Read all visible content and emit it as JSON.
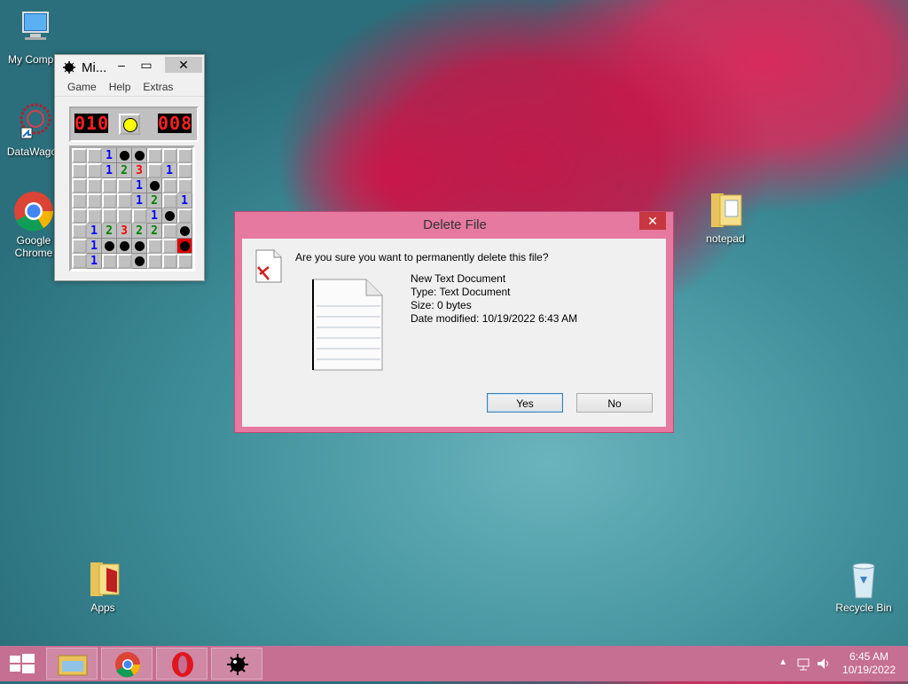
{
  "desktop": {
    "icons": [
      {
        "label": "My Compu",
        "icon": "computer-icon"
      },
      {
        "label": "DataWagor",
        "icon": "datawagon-icon"
      },
      {
        "label": "Google Chrome",
        "icon": "chrome-icon"
      },
      {
        "label": "notepad",
        "icon": "folder-icon"
      },
      {
        "label": "Apps",
        "icon": "folder-icon"
      },
      {
        "label": "Recycle Bin",
        "icon": "recycle-bin-icon"
      }
    ]
  },
  "minesweeper": {
    "title": "Mi...",
    "menu": [
      "Game",
      "Help",
      "Extras"
    ],
    "mine_counter": "010",
    "timer": "008",
    "face": "sad-face-icon",
    "grid": [
      [
        "c",
        "c",
        "1",
        "m",
        "m",
        "c",
        "c",
        "c"
      ],
      [
        "c",
        "c",
        "1",
        "2",
        "3",
        "c",
        "1",
        "c"
      ],
      [
        "c",
        "c",
        "c",
        "c",
        "1",
        "m",
        "c",
        "c"
      ],
      [
        "c",
        "c",
        "c",
        "c",
        "1",
        "2",
        "c",
        "1"
      ],
      [
        "c",
        "c",
        "c",
        "c",
        "c",
        "1",
        "m",
        "c"
      ],
      [
        "c",
        "1",
        "2",
        "3",
        "2",
        "2",
        "c",
        "m"
      ],
      [
        "c",
        "1",
        "m",
        "m",
        "m",
        "c",
        "c",
        "x"
      ],
      [
        "c",
        "1",
        "c",
        "c",
        "m",
        "c",
        "c",
        "c"
      ]
    ]
  },
  "dialog": {
    "title": "Delete File",
    "close": "✕",
    "question": "Are you sure you want to permanently delete this file?",
    "file_name": "New Text Document",
    "file_type": "Type: Text Document",
    "file_size": "Size: 0 bytes",
    "file_date": "Date modified: 10/19/2022 6:43 AM",
    "yes_label": "Yes",
    "no_label": "No"
  },
  "taskbar": {
    "apps": [
      "file-explorer-icon",
      "chrome-icon",
      "opera-icon",
      "minesweeper-icon"
    ],
    "time": "6:45 AM",
    "date": "10/19/2022"
  },
  "colors": {
    "dialog_frame": "#e5799f",
    "taskbar": "#c56f92",
    "close_red": "#c8373f"
  }
}
